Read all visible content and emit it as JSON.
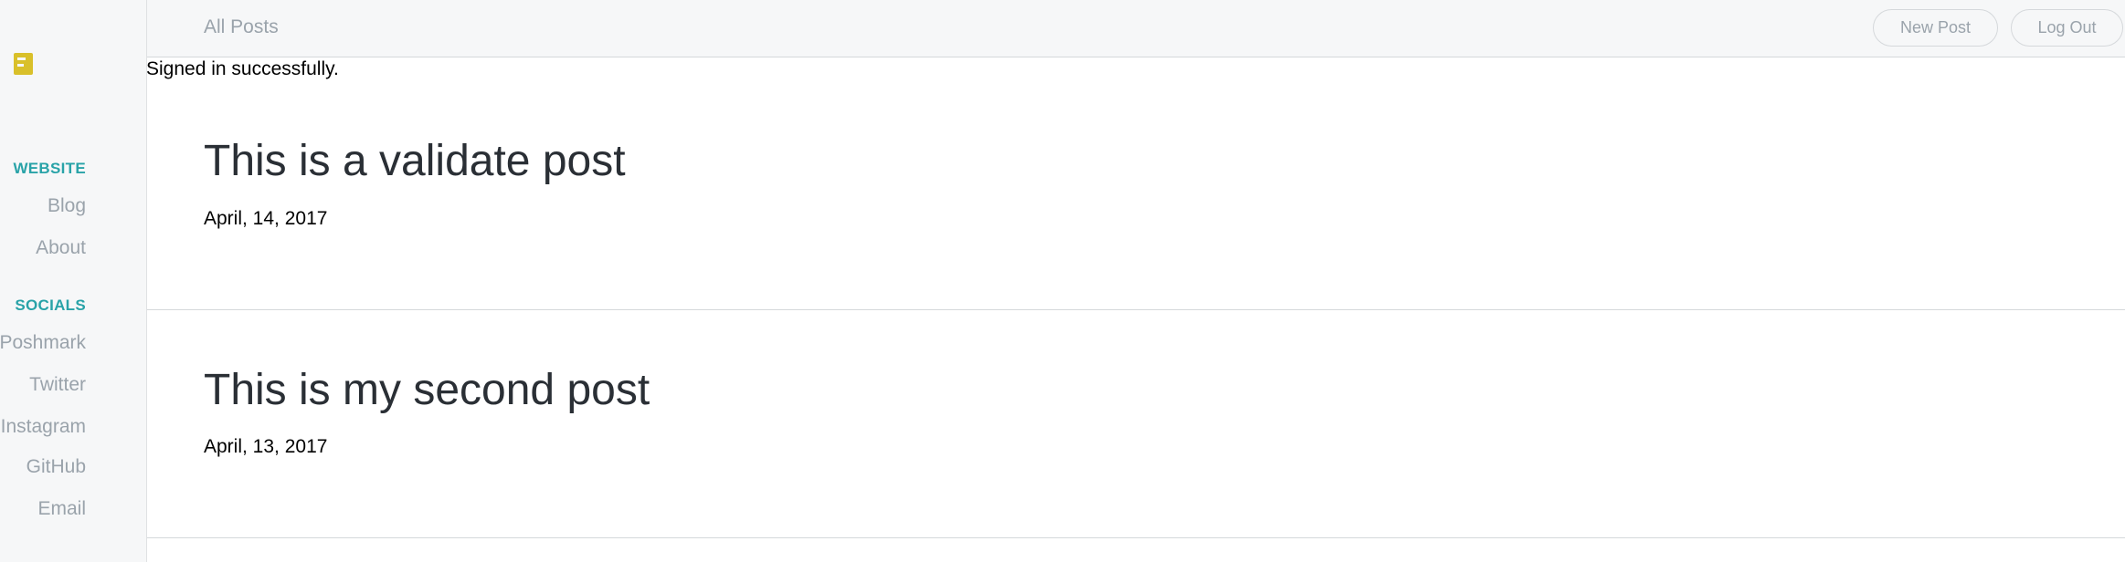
{
  "sidebar": {
    "logo": "logo-icon",
    "website_heading": "WEBSITE",
    "website_links": [
      "Blog",
      "About"
    ],
    "socials_heading": "SOCIALS",
    "social_links": [
      "Poshmark",
      "Twitter",
      "Instagram",
      "GitHub",
      "Email"
    ]
  },
  "topbar": {
    "title": "All Posts",
    "new_post_label": "New Post",
    "logout_label": "Log Out"
  },
  "flash": "Signed in successfully.",
  "posts": [
    {
      "title": "This is a validate post",
      "date": "April, 14, 2017"
    },
    {
      "title": "This is my second post",
      "date": "April, 13, 2017"
    }
  ],
  "colors": {
    "accent": "#29a3a8",
    "logo": "#d9c02a",
    "muted_text": "#9aa3ab",
    "sidebar_bg": "#f6f7f8"
  }
}
